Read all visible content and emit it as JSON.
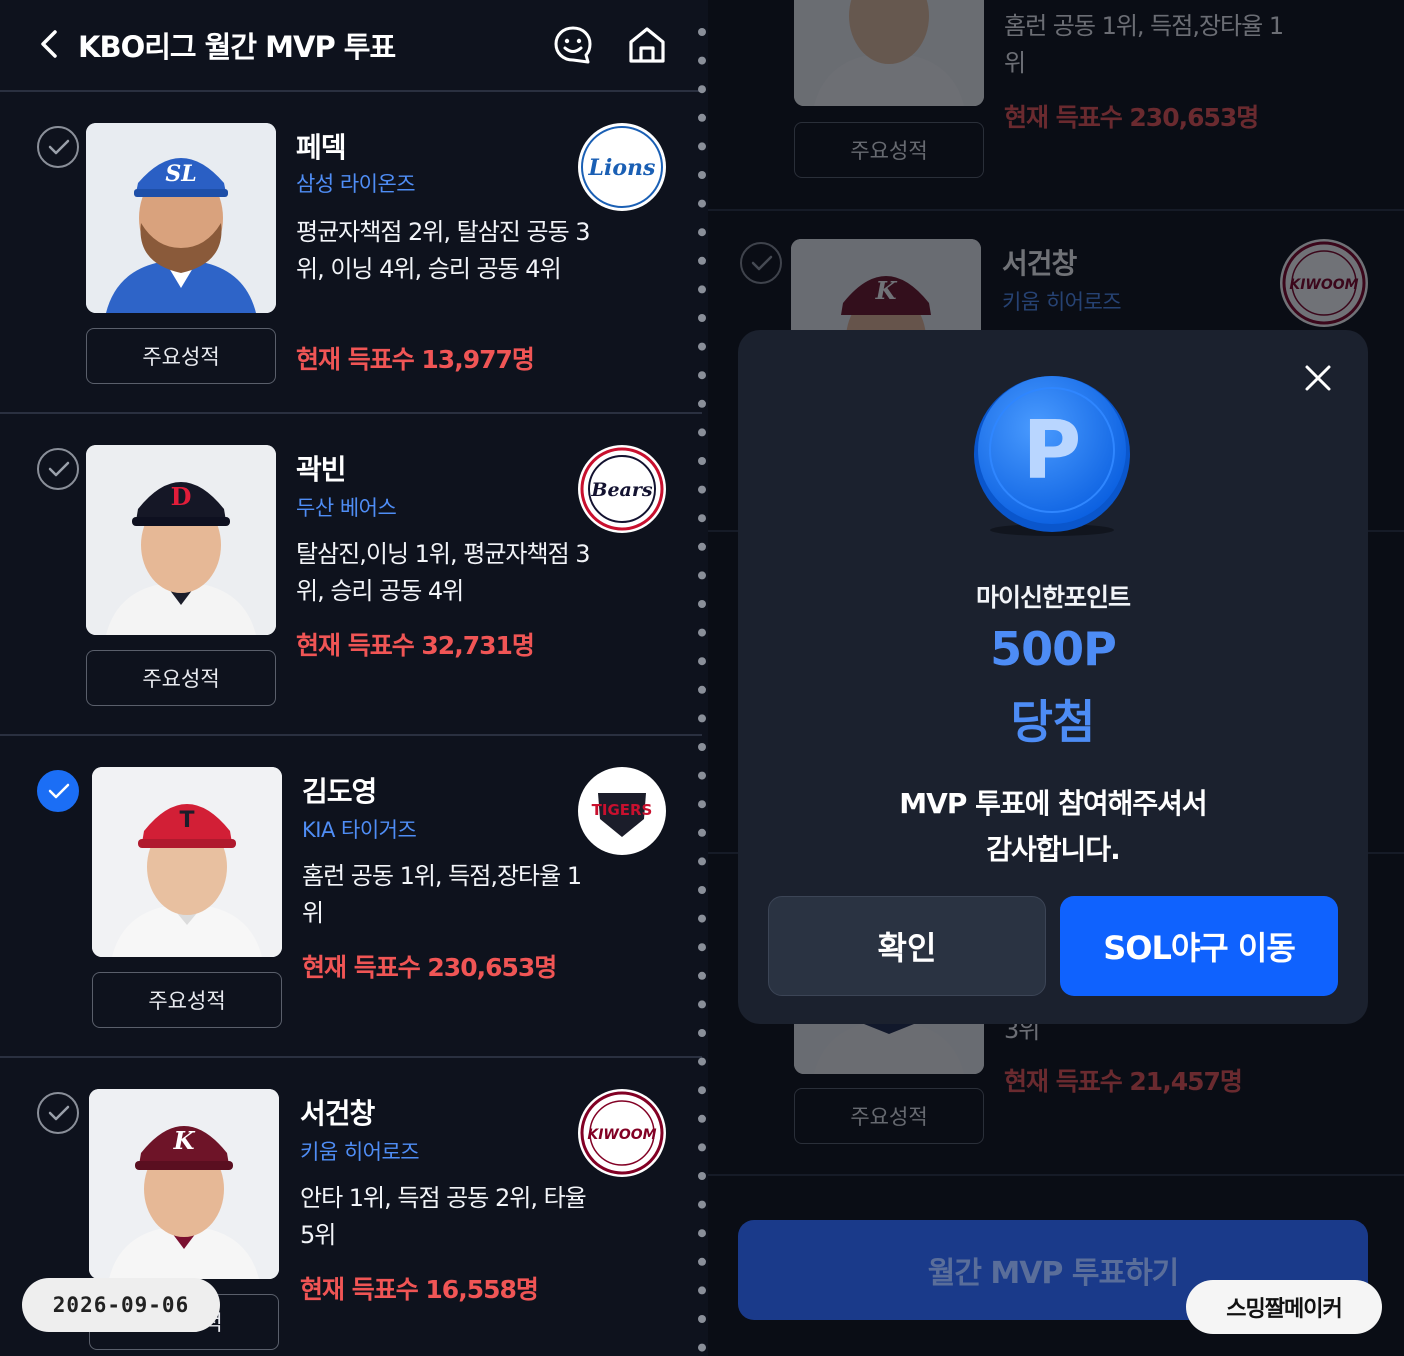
{
  "header": {
    "title": "KBO리그 월간 MVP 투표"
  },
  "players": [
    {
      "name": "페덱",
      "team": "삼성 라이온즈",
      "stats": "평균자책점 2위, 탈삼진 공동 3위, 이닝 4위, 승리 공동 4위",
      "votes": "현재 득표수 13,977명",
      "stats_button": "주요성적",
      "selected": false,
      "logo_text": "Lions",
      "logo_color": "#1a5fb4"
    },
    {
      "name": "곽빈",
      "team": "두산 베어스",
      "stats": "탈삼진,이닝 1위, 평균자책점 3위, 승리 공동 4위",
      "votes": "현재 득표수 32,731명",
      "stats_button": "주요성적",
      "selected": false,
      "logo_text": "Bears",
      "logo_color": "#131230"
    },
    {
      "name": "김도영",
      "team": "KIA 타이거즈",
      "stats": "홈런 공동 1위, 득점,장타율 1위",
      "votes": "현재 득표수 230,653명",
      "stats_button": "주요성적",
      "selected": true,
      "logo_text": "TIGERS",
      "logo_color": "#c8102e"
    },
    {
      "name": "서건창",
      "team": "키움 히어로즈",
      "stats": "안타 1위, 득점 공동 2위, 타율 5위",
      "votes": "현재 득표수 16,558명",
      "stats_button": "주요성적",
      "selected": false,
      "logo_text": "KIWOOM",
      "logo_color": "#820024"
    }
  ],
  "right": {
    "top_card": {
      "stats": "홈런 공동 1위, 득점,장타율 1위",
      "votes": "현재 득표수 230,653명",
      "stats_button": "주요성적"
    },
    "second_card": {
      "name": "서건창",
      "team": "키움 히어로즈"
    },
    "bottom_card": {
      "stats_tail": "3위",
      "votes": "현재 득표수 21,457명",
      "stats_button": "주요성적"
    },
    "vote_button": "월간 MVP 투표하기"
  },
  "modal": {
    "coin_letter": "P",
    "point_label": "마이신한포인트",
    "point_amount": "500P",
    "point_won": "당첨",
    "thanks_line1": "MVP 투표에 참여해주셔서",
    "thanks_line2": "감사합니다.",
    "ok_button": "확인",
    "sol_button": "SOL야구 이동"
  },
  "overlay": {
    "date": "2026-09-06",
    "maker": "스밍짤메이커"
  },
  "colors": {
    "accent_blue": "#0f62fe",
    "vote_red": "#f05555",
    "team_blue": "#4f8df5",
    "background": "#0e121d"
  }
}
